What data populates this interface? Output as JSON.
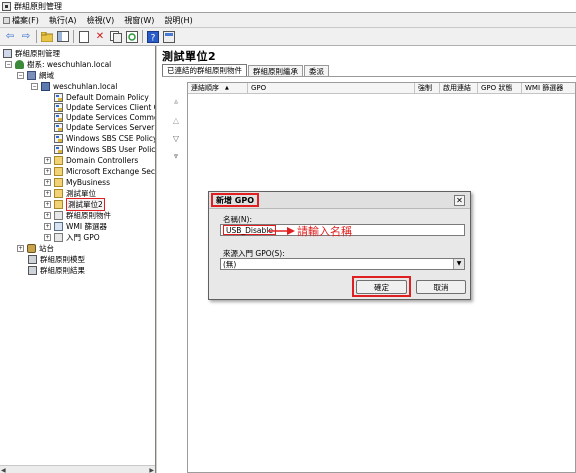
{
  "window": {
    "title": "群組原則管理"
  },
  "menubar": {
    "items": [
      {
        "label": "檔案(F)"
      },
      {
        "label": "執行(A)"
      },
      {
        "label": "檢視(V)"
      },
      {
        "label": "視窗(W)"
      },
      {
        "label": "說明(H)"
      }
    ]
  },
  "toolbar": {
    "buttons": [
      "back-icon",
      "forward-icon",
      "up-folder-icon",
      "show-hide-tree-icon",
      "properties-icon",
      "delete-icon",
      "copy-icon",
      "refresh-icon",
      "help-icon",
      "mmc-icon"
    ]
  },
  "tree": {
    "root": "群組原則管理",
    "forest": "樹系: weschuhlan.local",
    "domains": "網域",
    "domain": "weschuhlan.local",
    "gpos": [
      "Default Domain Policy",
      "Update Services Client Com",
      "Update Services Common S",
      "Update Services Server Con",
      "Windows SBS CSE Policy",
      "Windows SBS User Policy"
    ],
    "ous": [
      "Domain Controllers",
      "Microsoft Exchange Securit",
      "MyBusiness",
      "測試單位",
      "測試單位2"
    ],
    "gp_objects": "群組原則物件",
    "wmi_filters": "WMI 篩選器",
    "starter_gpos": "入門 GPO",
    "sites": "站台",
    "modeling": "群組原則模型",
    "results": "群組原則結果"
  },
  "main": {
    "title": "測試單位2",
    "tabs": [
      "已連結的群組原則物件",
      "群組原則繼承",
      "委派"
    ],
    "columns": [
      "連結順序",
      "GPO",
      "強制",
      "啟用連結",
      "GPO 狀態",
      "WMI 篩選器"
    ],
    "sort_glyph": "▲"
  },
  "dialog": {
    "title": "新增 GPO",
    "name_label": "名稱(N):",
    "name_value": "USB_Disable",
    "source_label": "來源入門 GPO(S):",
    "source_value": "(無)",
    "ok_label": "確定",
    "cancel_label": "取消"
  },
  "annotation": {
    "text": "請輸入名稱",
    "color": "#e02020"
  }
}
